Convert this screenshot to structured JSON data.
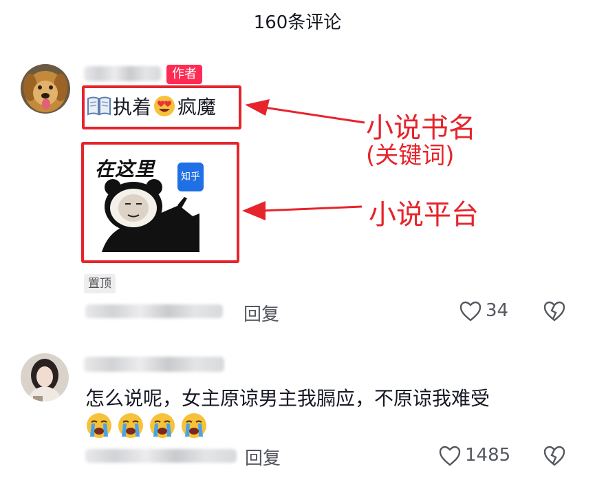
{
  "header": {
    "title": "160条评论"
  },
  "comments": [
    {
      "author_badge": "作者",
      "text_part1": "执着",
      "text_part2": "疯魔",
      "sticker": {
        "caption": "在这里",
        "app_label": "知乎"
      },
      "pinned_label": "置顶",
      "reply_label": "回复",
      "like_count": "34"
    },
    {
      "text_line1": "怎么说呢，女主原谅男主我膈应，不原谅我难受",
      "reply_label": "回复",
      "like_count": "1485"
    }
  ],
  "annotations": {
    "book_title": "小说书名",
    "book_title_note": "(关键词)",
    "platform": "小说平台"
  },
  "colors": {
    "annotation_red": "#e6242b",
    "badge_pink": "#fe2c55",
    "text_gray": "#55575f"
  }
}
